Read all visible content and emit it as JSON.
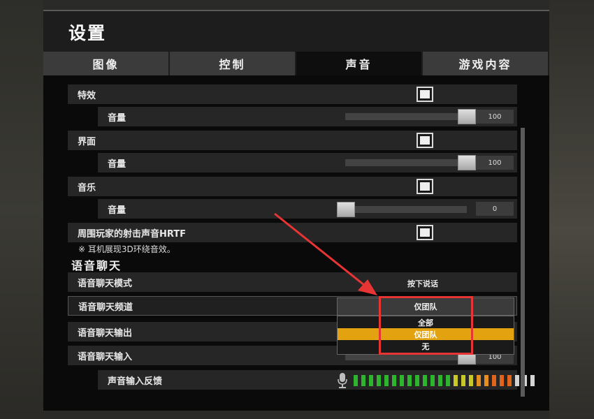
{
  "title": "设置",
  "tabs": [
    {
      "label": "图像"
    },
    {
      "label": "控制"
    },
    {
      "label": "声音"
    },
    {
      "label": "游戏内容"
    }
  ],
  "sound": {
    "effects": {
      "label": "特效",
      "volume_label": "音量",
      "volume_value": "100",
      "volume": 100
    },
    "ui": {
      "label": "界面",
      "volume_label": "音量",
      "volume_value": "100",
      "volume": 100
    },
    "music": {
      "label": "音乐",
      "volume_label": "音量",
      "volume_value": "0",
      "volume": 0
    },
    "hrtf": {
      "label": "周围玩家的射击声音HRTF",
      "note": "※ 耳机展现3D环绕音效。"
    }
  },
  "voice_chat": {
    "section_title": "语音聊天",
    "mode": {
      "label": "语音聊天模式",
      "value": "按下说话"
    },
    "channel": {
      "label": "语音聊天频道",
      "value": "仅团队",
      "options": [
        "全部",
        "仅团队",
        "无"
      ],
      "selected_index": 1
    },
    "output": {
      "label": "语音聊天输出"
    },
    "input": {
      "label": "语音聊天输入",
      "volume_value": "100"
    },
    "feedback": {
      "label": "声音输入反馈"
    }
  },
  "meter_colors": [
    "#2db52d",
    "#2db52d",
    "#2db52d",
    "#2db52d",
    "#2db52d",
    "#2db52d",
    "#2db52d",
    "#2db52d",
    "#2db52d",
    "#2db52d",
    "#2db52d",
    "#2db52d",
    "#2db52d",
    "#c8c829",
    "#c8c829",
    "#c8c829",
    "#e88d1f",
    "#e88d1f",
    "#e0641c",
    "#e0641c",
    "#e0641c",
    "#d4d4d4",
    "#d4d4d4",
    "#d4d4d4"
  ],
  "colors": {
    "accent": "#e3a20f",
    "highlight": "#e73434"
  }
}
